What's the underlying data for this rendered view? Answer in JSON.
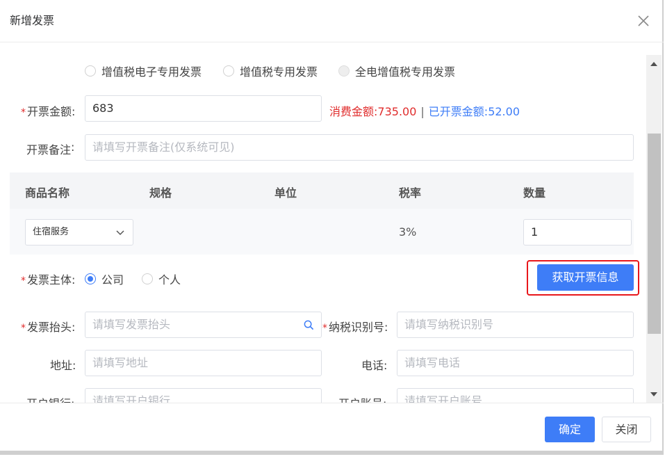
{
  "dialog": {
    "title": "新增发票"
  },
  "invoice_types": [
    {
      "label": "增值税电子专用发票",
      "checked": false,
      "disabled": false
    },
    {
      "label": "增值税专用发票",
      "checked": false,
      "disabled": false
    },
    {
      "label": "全电增值税专用发票",
      "checked": false,
      "disabled": true
    }
  ],
  "amount": {
    "label": "开票金额:",
    "value": "683",
    "consumed_label": "消费金额:",
    "consumed_value": "735.00",
    "separator": "|",
    "invoiced_label": "已开票金额:",
    "invoiced_value": "52.00"
  },
  "remark": {
    "label": "开票备注",
    "placeholder": "请填写开票备注(仅系统可见)"
  },
  "goods_table": {
    "headers": [
      "商品名称",
      "规格",
      "单位",
      "税率",
      "数量"
    ],
    "row": {
      "name": "住宿服务",
      "spec": "",
      "unit": "",
      "tax_rate": "3%",
      "quantity": "1"
    }
  },
  "subject": {
    "label": "发票主体:",
    "options": [
      {
        "label": "公司",
        "checked": true
      },
      {
        "label": "个人",
        "checked": false
      }
    ],
    "fetch_button": "获取开票信息"
  },
  "fields": {
    "header": {
      "label": "发票抬头",
      "placeholder": "请填写发票抬头"
    },
    "tax_id": {
      "label": "纳税识别号",
      "placeholder": "请填写纳税识别号"
    },
    "address": {
      "label": "地址",
      "placeholder": "请填写地址"
    },
    "phone": {
      "label": "电话",
      "placeholder": "请填写电话"
    },
    "bank": {
      "label": "开户银行",
      "placeholder": "请填写开户银行"
    },
    "account": {
      "label": "开户账号",
      "placeholder": "请填写开户账号"
    }
  },
  "footer": {
    "confirm": "确定",
    "close": "关闭"
  },
  "colors": {
    "primary": "#3e7df7",
    "danger": "#e02c2c",
    "highlight_border": "#e8161b"
  }
}
